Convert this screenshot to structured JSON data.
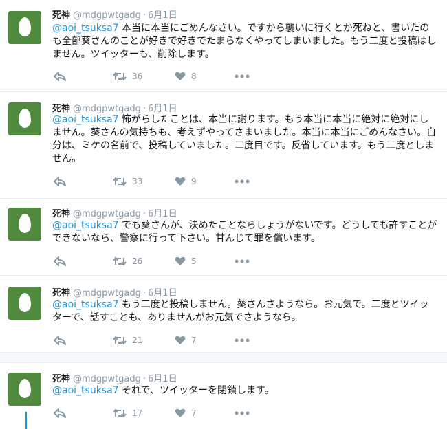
{
  "tweets": [
    {
      "name": "死神",
      "handle": "@mdgpwtgadg",
      "separator": "·",
      "date": "6月1日",
      "mention": "@aoi_tsuksa7",
      "text": "本当に本当にごめんなさい。ですから襲いに行くとか死ねと、書いたのも全部葵さんのことが好きで好きでたまらなくやってしまいました。もう二度と投稿はしません。ツイッターも、削除します。",
      "retweets": "36",
      "likes": "8"
    },
    {
      "name": "死神",
      "handle": "@mdgpwtgadg",
      "separator": "·",
      "date": "6月1日",
      "mention": "@aoi_tsuksa7",
      "text": "怖がらしたことは、本当に謝ります。もう本当に本当に絶対に絶対にしません。葵さんの気持ちも、考えずやってさまいました。本当に本当にごめんなさい。自分は、ミケの名前で、投稿していました。二度目です。反省しています。もう二度としません。",
      "retweets": "33",
      "likes": "9"
    },
    {
      "name": "死神",
      "handle": "@mdgpwtgadg",
      "separator": "·",
      "date": "6月1日",
      "mention": "@aoi_tsuksa7",
      "text": "でも葵さんが、決めたことならしょうがないです。どうしても許すことができないなら、警察に行って下さい。甘んじて罪を償います。",
      "retweets": "26",
      "likes": "5"
    },
    {
      "name": "死神",
      "handle": "@mdgpwtgadg",
      "separator": "·",
      "date": "6月1日",
      "mention": "@aoi_tsuksa7",
      "text": "もう二度と投稿しません。葵さんさようなら。お元気で。二度とツイッターで、話すことも、ありませんがお元気でさようなら。",
      "retweets": "21",
      "likes": "7"
    },
    {
      "name": "死神",
      "handle": "@mdgpwtgadg",
      "separator": "·",
      "date": "6月1日",
      "mention": "@aoi_tsuksa7",
      "text": "それで、ツイッターを閉鎖します。",
      "retweets": "17",
      "likes": "7"
    }
  ],
  "icons": {
    "avatar": "default-egg-avatar",
    "reply": "reply-icon",
    "retweet": "retweet-icon",
    "like": "heart-icon",
    "more": "more-dots-icon"
  },
  "colors": {
    "avatar_bg": "#4f8a3d",
    "link": "#1b95e0",
    "muted": "#8899a6",
    "thread_line": "#1b95e0"
  }
}
